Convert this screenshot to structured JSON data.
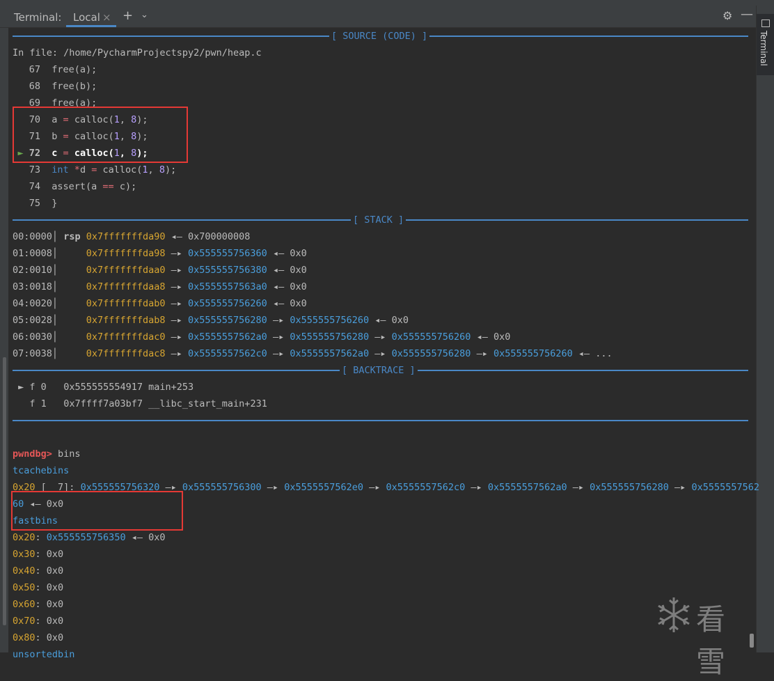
{
  "tabbar": {
    "title": "Terminal:",
    "active_tab": "Local",
    "close_glyph": "×",
    "add_glyph": "+",
    "dropdown_glyph": "⌄",
    "gear_glyph": "⚙",
    "minimize_glyph": "—"
  },
  "rightbar": {
    "label": "Terminal"
  },
  "terminal": {
    "source_header": "[ SOURCE (CODE) ]",
    "in_file": "In file: /home/PycharmProjectspy2/pwn/heap.c",
    "code_lines": [
      {
        "no": "67",
        "code": "free(a);"
      },
      {
        "no": "68",
        "code": "free(b);"
      },
      {
        "no": "69",
        "code": "free(a);"
      },
      {
        "no": "70",
        "var": "a",
        "call": "calloc(",
        "a1": "1",
        "comma": ", ",
        "a2": "8",
        "end": ");"
      },
      {
        "no": "71",
        "var": "b",
        "call": "calloc(",
        "a1": "1",
        "comma": ", ",
        "a2": "8",
        "end": ");"
      },
      {
        "no": "72",
        "var": "c",
        "call": "calloc(",
        "a1": "1",
        "comma": ", ",
        "a2": "8",
        "end": ");",
        "marker": "►"
      },
      {
        "no": "73",
        "type": "int",
        "var": "d",
        "call": "calloc(",
        "a1": "1",
        "comma": ", ",
        "a2": "8",
        "end": ");"
      },
      {
        "no": "74",
        "code_a": "assert(a ",
        "op": "==",
        "code_b": " c);"
      },
      {
        "no": "75",
        "code": "}"
      }
    ],
    "stack_header": "[ STACK ]",
    "stack_rows": [
      {
        "off": "00:0000",
        "reg": "rsp",
        "chain": [
          [
            "y",
            "0x7fffffffda90"
          ],
          [
            "a",
            " ◂— "
          ],
          [
            "g",
            "0x700000008"
          ]
        ]
      },
      {
        "off": "01:0008",
        "chain": [
          [
            "y",
            "0x7fffffffda98"
          ],
          [
            "a",
            " —▸ "
          ],
          [
            "b",
            "0x555555756360"
          ],
          [
            "a",
            " ◂— "
          ],
          [
            "g",
            "0x0"
          ]
        ]
      },
      {
        "off": "02:0010",
        "chain": [
          [
            "y",
            "0x7fffffffdaa0"
          ],
          [
            "a",
            " —▸ "
          ],
          [
            "b",
            "0x555555756380"
          ],
          [
            "a",
            " ◂— "
          ],
          [
            "g",
            "0x0"
          ]
        ]
      },
      {
        "off": "03:0018",
        "chain": [
          [
            "y",
            "0x7fffffffdaa8"
          ],
          [
            "a",
            " —▸ "
          ],
          [
            "b",
            "0x5555557563a0"
          ],
          [
            "a",
            " ◂— "
          ],
          [
            "g",
            "0x0"
          ]
        ]
      },
      {
        "off": "04:0020",
        "chain": [
          [
            "y",
            "0x7fffffffdab0"
          ],
          [
            "a",
            " —▸ "
          ],
          [
            "b",
            "0x555555756260"
          ],
          [
            "a",
            " ◂— "
          ],
          [
            "g",
            "0x0"
          ]
        ]
      },
      {
        "off": "05:0028",
        "chain": [
          [
            "y",
            "0x7fffffffdab8"
          ],
          [
            "a",
            " —▸ "
          ],
          [
            "b",
            "0x555555756280"
          ],
          [
            "a",
            " —▸ "
          ],
          [
            "b",
            "0x555555756260"
          ],
          [
            "a",
            " ◂— "
          ],
          [
            "g",
            "0x0"
          ]
        ]
      },
      {
        "off": "06:0030",
        "chain": [
          [
            "y",
            "0x7fffffffdac0"
          ],
          [
            "a",
            " —▸ "
          ],
          [
            "b",
            "0x5555557562a0"
          ],
          [
            "a",
            " —▸ "
          ],
          [
            "b",
            "0x555555756280"
          ],
          [
            "a",
            " —▸ "
          ],
          [
            "b",
            "0x555555756260"
          ],
          [
            "a",
            " ◂— "
          ],
          [
            "g",
            "0x0"
          ]
        ]
      },
      {
        "off": "07:0038",
        "chain": [
          [
            "y",
            "0x7fffffffdac8"
          ],
          [
            "a",
            " —▸ "
          ],
          [
            "b",
            "0x5555557562c0"
          ],
          [
            "a",
            " —▸ "
          ],
          [
            "b",
            "0x5555557562a0"
          ],
          [
            "a",
            " —▸ "
          ],
          [
            "b",
            "0x555555756280"
          ],
          [
            "a",
            " —▸ "
          ],
          [
            "b",
            "0x555555756260"
          ],
          [
            "a",
            " ◂— ..."
          ]
        ]
      }
    ],
    "backtrace_header": "[ BACKTRACE ]",
    "backtrace": [
      {
        "marker": "►",
        "frame": "f 0",
        "addr": "0x555555554917",
        "sym": "main+253"
      },
      {
        "marker": "",
        "frame": "f 1",
        "addr": "0x7ffff7a03bf7",
        "sym": "__libc_start_main+231"
      }
    ],
    "prompt": "pwndbg>",
    "command": "bins",
    "tcache_label": "tcachebins",
    "tcache_size": "0x20",
    "tcache_count": " [  7]",
    "tcache_chain": [
      [
        "b",
        "0x555555756320"
      ],
      [
        "a",
        " —▸ "
      ],
      [
        "b",
        "0x555555756300"
      ],
      [
        "a",
        " —▸ "
      ],
      [
        "b",
        "0x5555557562e0"
      ],
      [
        "a",
        " —▸ "
      ],
      [
        "b",
        "0x5555557562c0"
      ],
      [
        "a",
        " —▸ "
      ],
      [
        "b",
        "0x5555557562a0"
      ],
      [
        "a",
        " —▸ "
      ],
      [
        "b",
        "0x555555756280"
      ],
      [
        "a",
        " —▸ "
      ],
      [
        "b",
        "0x5555557562"
      ]
    ],
    "tcache_wrap": [
      [
        "b",
        "60"
      ],
      [
        "a",
        " ◂— "
      ],
      [
        "g",
        "0x0"
      ]
    ],
    "fastbins_label": "fastbins",
    "fastbins": [
      {
        "size": "0x20",
        "chain": [
          [
            "b",
            "0x555555756350"
          ],
          [
            "a",
            " ◂— "
          ],
          [
            "g",
            "0x0"
          ]
        ]
      },
      {
        "size": "0x30",
        "chain": [
          [
            "g",
            "0x0"
          ]
        ]
      },
      {
        "size": "0x40",
        "chain": [
          [
            "g",
            "0x0"
          ]
        ]
      },
      {
        "size": "0x50",
        "chain": [
          [
            "g",
            "0x0"
          ]
        ]
      },
      {
        "size": "0x60",
        "chain": [
          [
            "g",
            "0x0"
          ]
        ]
      },
      {
        "size": "0x70",
        "chain": [
          [
            "g",
            "0x0"
          ]
        ]
      },
      {
        "size": "0x80",
        "chain": [
          [
            "g",
            "0x0"
          ]
        ]
      }
    ],
    "unsorted_label": "unsortedbin"
  },
  "watermark": {
    "icon": "snowflake-icon",
    "text": "看雪"
  },
  "colors": {
    "bg": "#2b2b2b",
    "accent": "#4a88c7",
    "address_yellow": "#d7a531",
    "address_blue": "#4a9edc",
    "highlight_red": "#e53935"
  }
}
